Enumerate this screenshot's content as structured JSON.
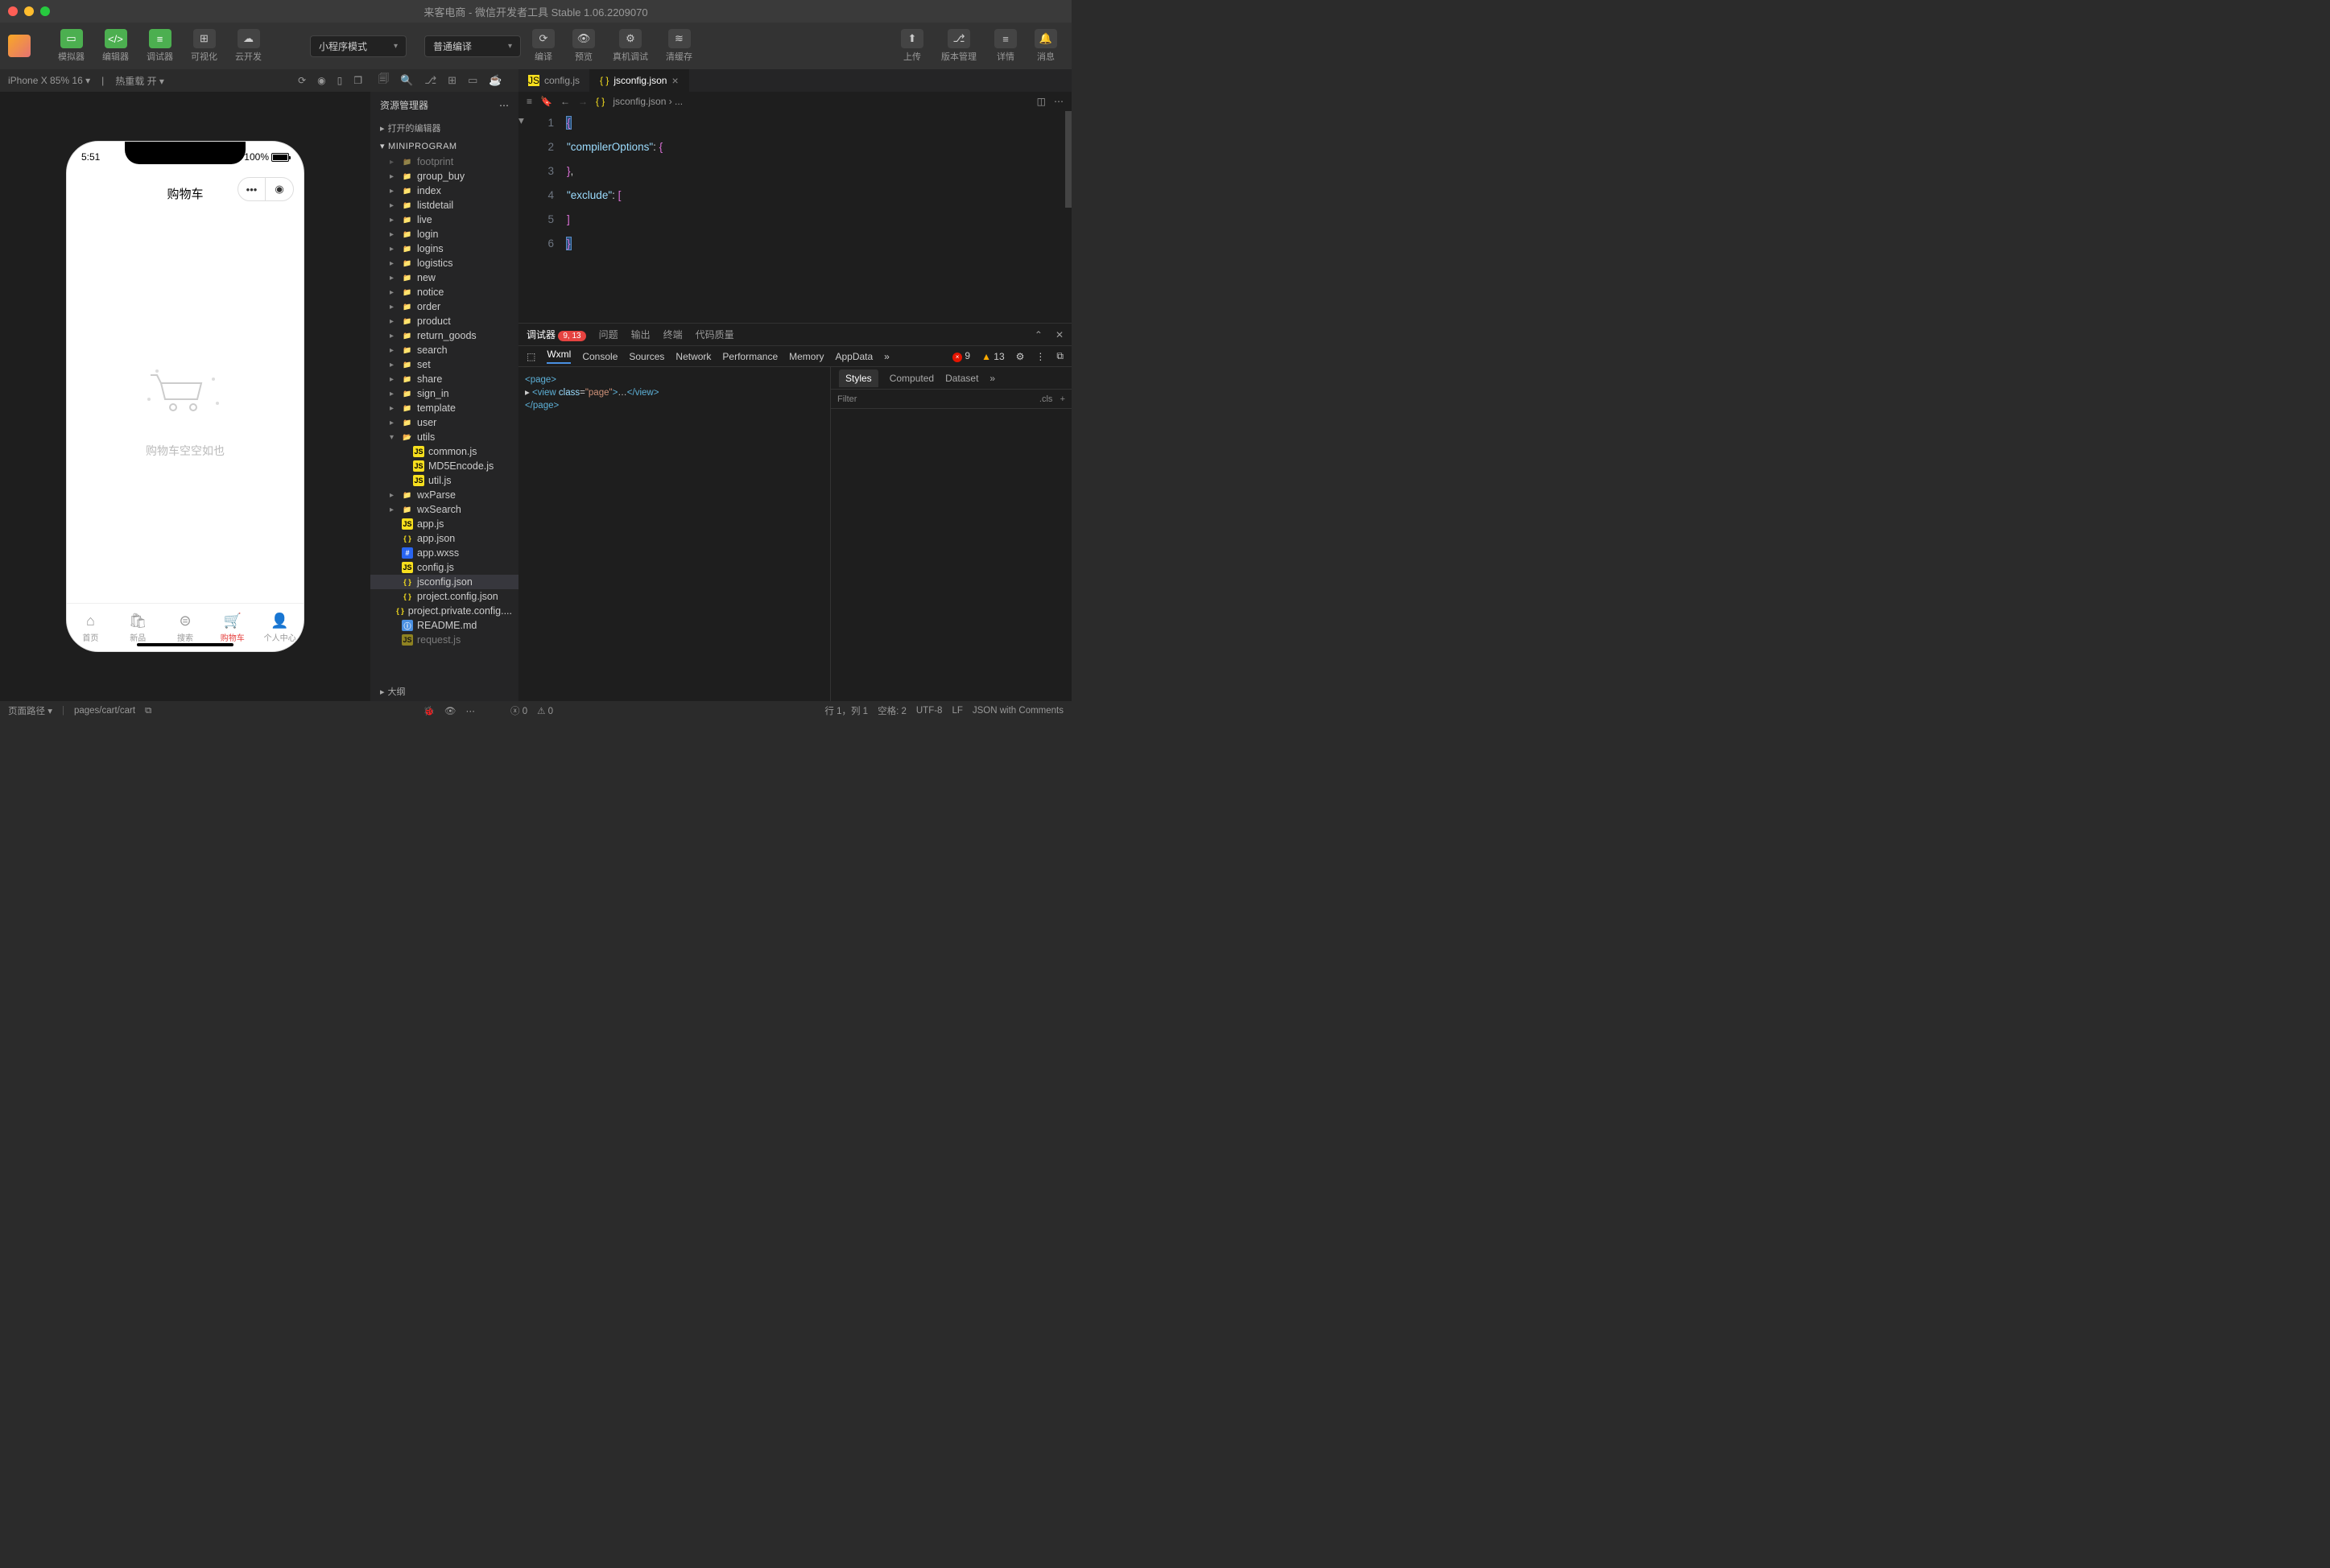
{
  "window": {
    "title": "来客电商 - 微信开发者工具 Stable 1.06.2209070"
  },
  "toolbar": {
    "simulator": "模拟器",
    "editor": "编辑器",
    "debugger": "调试器",
    "visual": "可视化",
    "cloud": "云开发",
    "mode": "小程序模式",
    "compile": "普通编译",
    "compile_btn": "编译",
    "preview": "预览",
    "remote": "真机调试",
    "clear": "清缓存",
    "upload": "上传",
    "version": "版本管理",
    "detail": "详情",
    "message": "消息"
  },
  "simHeader": {
    "device": "iPhone X 85% 16",
    "hot": "热重载 开"
  },
  "phone": {
    "time": "5:51",
    "battery": "100%",
    "pageTitle": "购物车",
    "empty": "购物车空空如也",
    "tabs": [
      {
        "label": "首页",
        "icon": "⌂"
      },
      {
        "label": "新品",
        "icon": "🛍"
      },
      {
        "label": "搜索",
        "icon": "⊜"
      },
      {
        "label": "购物车",
        "icon": "🛒",
        "active": true
      },
      {
        "label": "个人中心",
        "icon": "👤"
      }
    ]
  },
  "explorer": {
    "title": "资源管理器",
    "openEditors": "打开的编辑器",
    "project": "MINIPROGRAM",
    "outline": "大纲",
    "tree": [
      {
        "name": "footprint",
        "type": "folder",
        "cut": true
      },
      {
        "name": "group_buy",
        "type": "folder"
      },
      {
        "name": "index",
        "type": "folder"
      },
      {
        "name": "listdetail",
        "type": "folder"
      },
      {
        "name": "live",
        "type": "folder"
      },
      {
        "name": "login",
        "type": "folder"
      },
      {
        "name": "logins",
        "type": "folder"
      },
      {
        "name": "logistics",
        "type": "folder"
      },
      {
        "name": "new",
        "type": "folder"
      },
      {
        "name": "notice",
        "type": "folder"
      },
      {
        "name": "order",
        "type": "folder"
      },
      {
        "name": "product",
        "type": "folder"
      },
      {
        "name": "return_goods",
        "type": "folder"
      },
      {
        "name": "search",
        "type": "folder"
      },
      {
        "name": "set",
        "type": "folder"
      },
      {
        "name": "share",
        "type": "folder"
      },
      {
        "name": "sign_in",
        "type": "folder"
      },
      {
        "name": "template",
        "type": "folder"
      },
      {
        "name": "user",
        "type": "folder"
      },
      {
        "name": "utils",
        "type": "folder-open",
        "open": true
      },
      {
        "name": "common.js",
        "type": "js",
        "indent": 1
      },
      {
        "name": "MD5Encode.js",
        "type": "js",
        "indent": 1
      },
      {
        "name": "util.js",
        "type": "js",
        "indent": 1
      },
      {
        "name": "wxParse",
        "type": "folder"
      },
      {
        "name": "wxSearch",
        "type": "folder"
      },
      {
        "name": "app.js",
        "type": "js"
      },
      {
        "name": "app.json",
        "type": "json"
      },
      {
        "name": "app.wxss",
        "type": "wxss"
      },
      {
        "name": "config.js",
        "type": "js"
      },
      {
        "name": "jsconfig.json",
        "type": "json",
        "selected": true
      },
      {
        "name": "project.config.json",
        "type": "json"
      },
      {
        "name": "project.private.config....",
        "type": "json"
      },
      {
        "name": "README.md",
        "type": "md"
      },
      {
        "name": "request.js",
        "type": "js",
        "cut": true
      }
    ]
  },
  "editor": {
    "tabs": [
      {
        "name": "config.js",
        "icon": "js"
      },
      {
        "name": "jsconfig.json",
        "icon": "json",
        "active": true
      }
    ],
    "breadcrumb": "jsconfig.json › ...",
    "lines": [
      {
        "n": 1,
        "html": "<span class='brace hl'>{</span>"
      },
      {
        "n": 2,
        "html": "  <span class='str'>\"compilerOptions\"</span><span class='punct'>:</span> <span class='brace'>{</span>"
      },
      {
        "n": 3,
        "html": "  <span class='brace'>}</span><span class='punct'>,</span>"
      },
      {
        "n": 4,
        "html": "  <span class='str'>\"exclude\"</span><span class='punct'>:</span> <span class='brace'>[</span>"
      },
      {
        "n": 5,
        "html": "  <span class='brace'>]</span>"
      },
      {
        "n": 6,
        "html": "<span class='brace hl'>}</span>"
      }
    ]
  },
  "debugger": {
    "tab": "调试器",
    "badge": "9, 13",
    "tabs": [
      "问题",
      "输出",
      "终端",
      "代码质量"
    ],
    "tools": [
      "Wxml",
      "Console",
      "Sources",
      "Network",
      "Performance",
      "Memory",
      "AppData"
    ],
    "errCount": "9",
    "warnCount": "13",
    "wxml": [
      "<span class='tag'>&lt;page&gt;</span>",
      "  ▸ <span class='tag'>&lt;view</span> <span class='attr'>class</span>=<span class='val'>\"page\"</span><span class='tag'>&gt;</span>…<span class='tag'>&lt;/view&gt;</span>",
      "<span class='tag'>&lt;/page&gt;</span>"
    ],
    "stylesTabs": [
      "Styles",
      "Computed",
      "Dataset"
    ],
    "filter": "Filter",
    "cls": ".cls"
  },
  "status": {
    "pathLabel": "页面路径",
    "path": "pages/cart/cart",
    "err": "0",
    "warn": "0",
    "pos": "行 1，列 1",
    "spaces": "空格: 2",
    "enc": "UTF-8",
    "eol": "LF",
    "lang": "JSON with Comments"
  }
}
